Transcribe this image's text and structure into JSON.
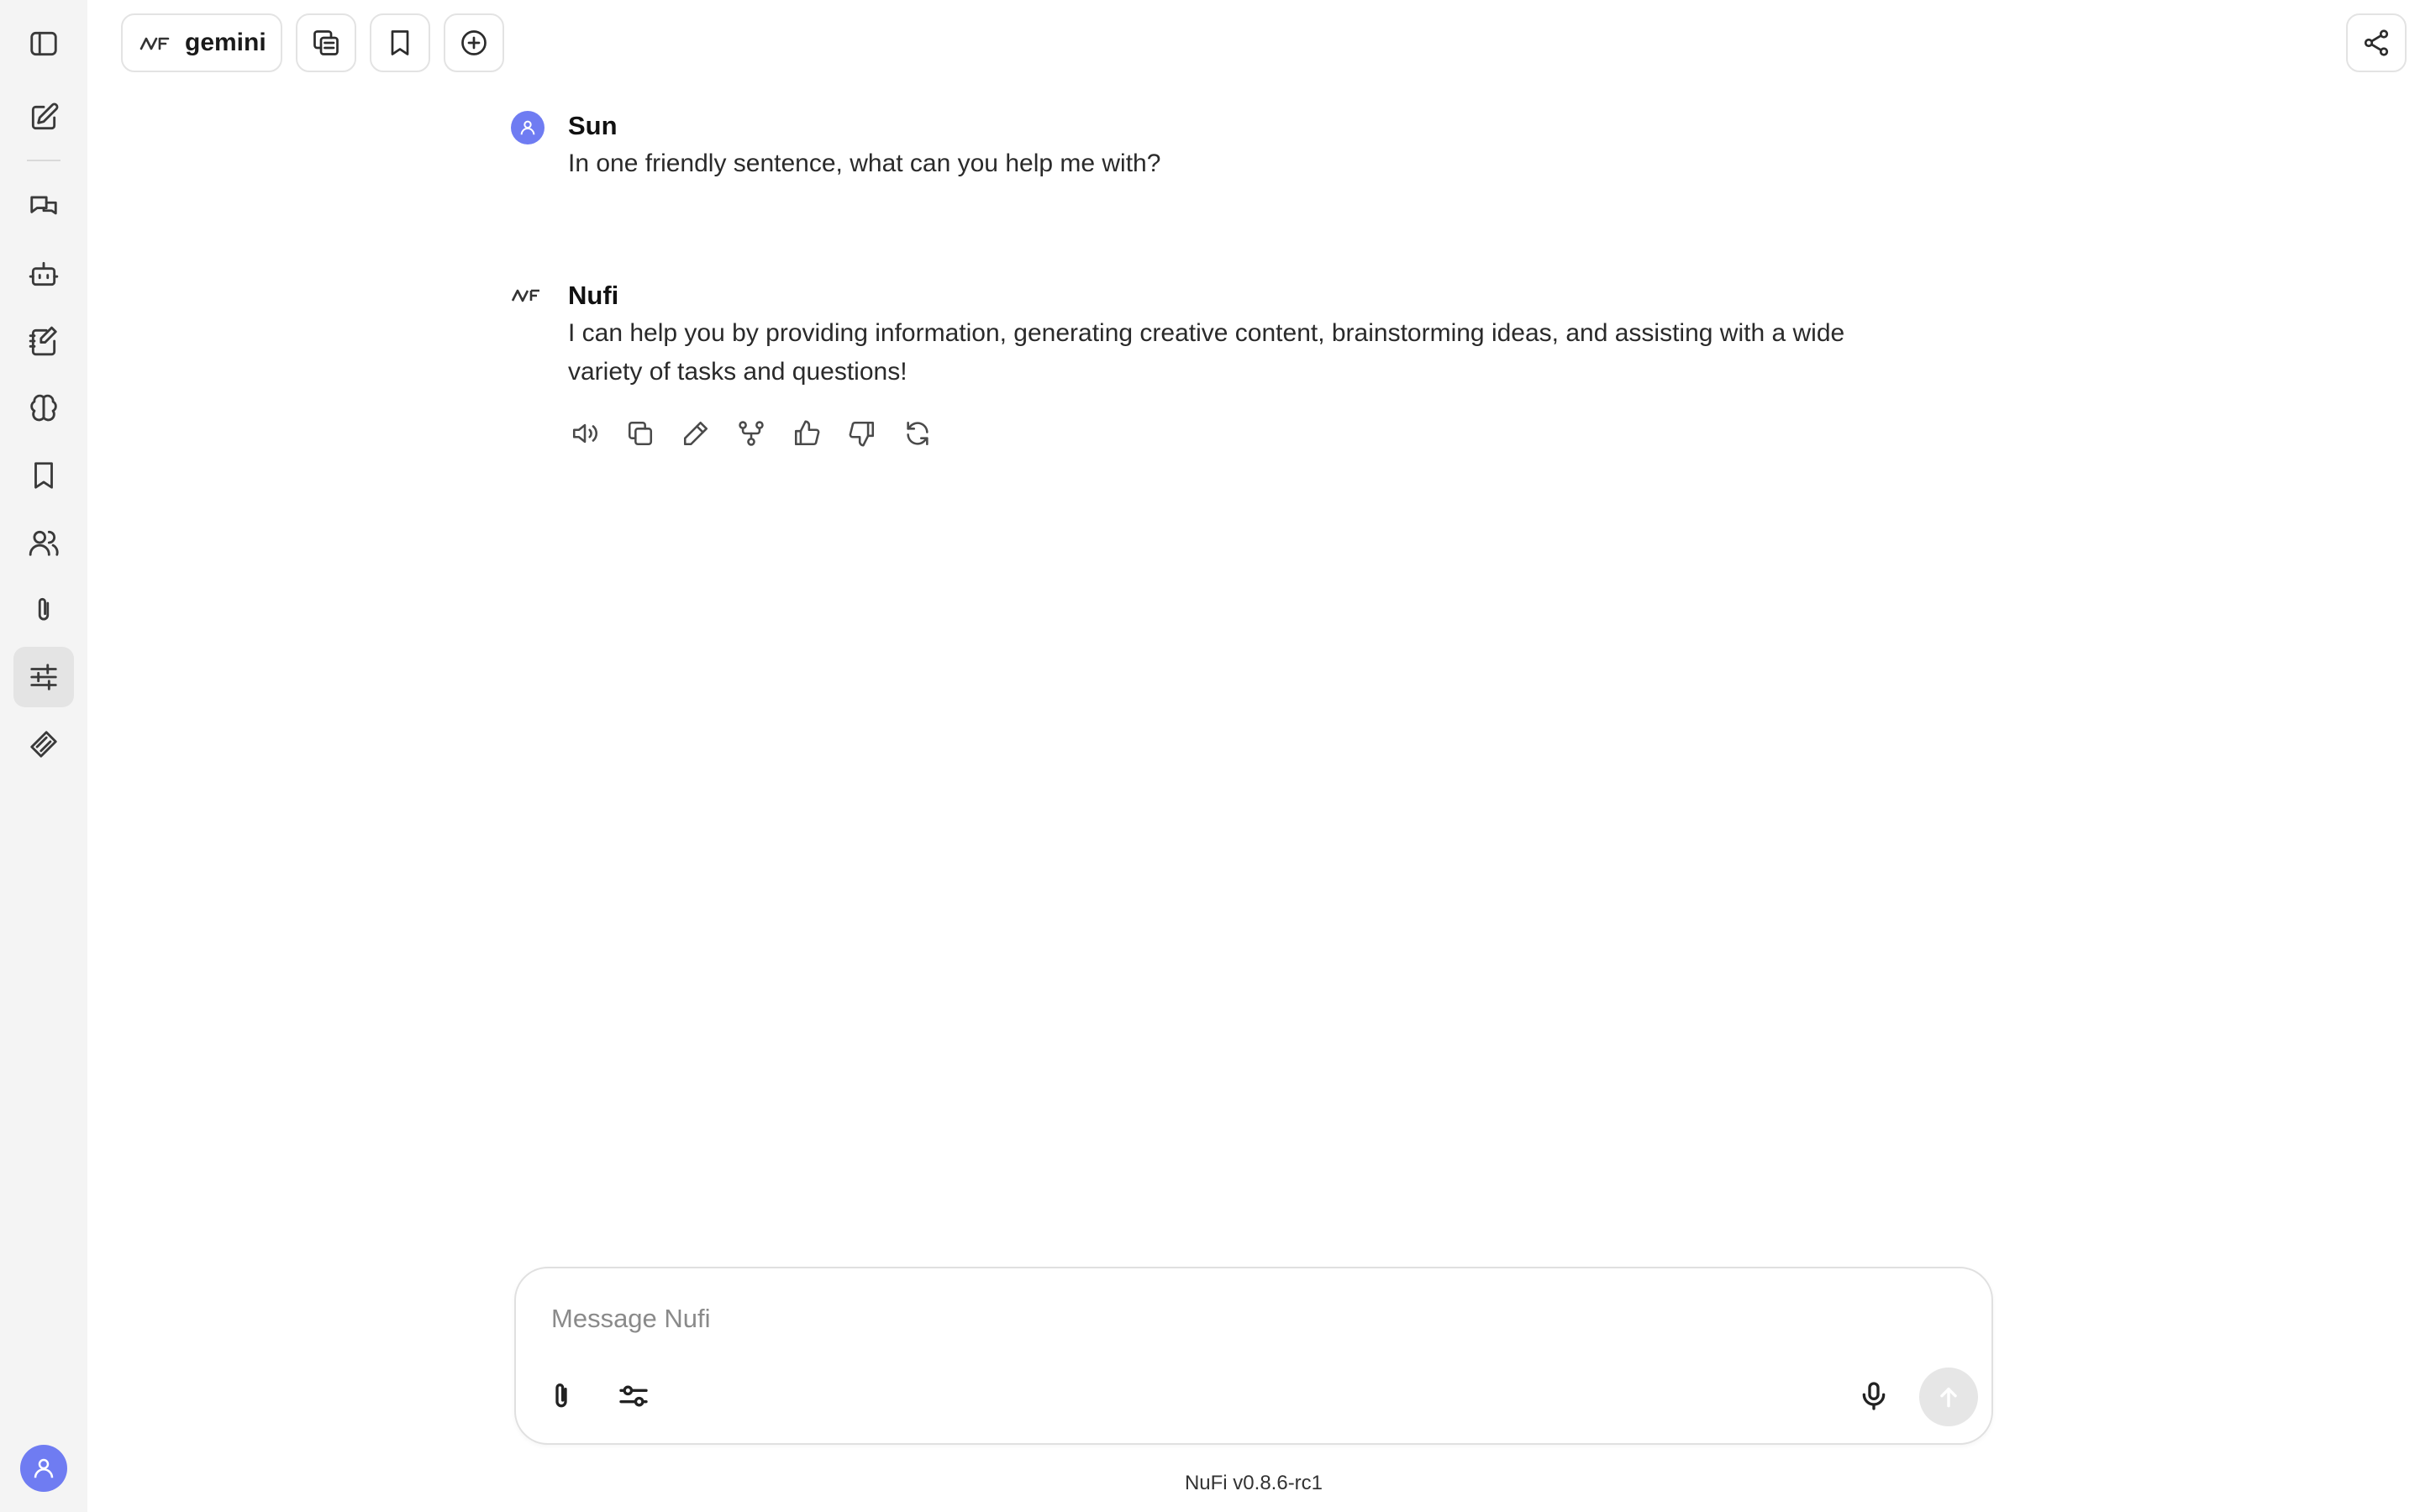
{
  "header": {
    "model_label": "gemini"
  },
  "sidebar": {
    "items": [
      {
        "icon": "sidebar-toggle-icon"
      },
      {
        "icon": "new-chat-icon"
      },
      {
        "icon": "conversations-icon"
      },
      {
        "icon": "agents-icon"
      },
      {
        "icon": "prompts-icon"
      },
      {
        "icon": "memories-icon"
      },
      {
        "icon": "bookmarks-icon"
      },
      {
        "icon": "users-icon"
      },
      {
        "icon": "attachments-icon"
      },
      {
        "icon": "parameters-icon",
        "active": true
      },
      {
        "icon": "tools-icon"
      }
    ]
  },
  "messages": [
    {
      "author": "Sun",
      "text": "In one friendly sentence, what can you help me with?"
    },
    {
      "author": "Nufi",
      "text": "I can help you by providing information, generating creative content, brainstorming ideas, and assisting with a wide variety of tasks and questions!"
    }
  ],
  "message_actions": [
    "read-aloud-icon",
    "copy-icon",
    "edit-icon",
    "fork-icon",
    "thumbs-up-icon",
    "thumbs-down-icon",
    "regenerate-icon"
  ],
  "composer": {
    "placeholder": "Message Nufi"
  },
  "footer": {
    "version": "NuFi v0.8.6-rc1"
  },
  "colors": {
    "accent": "#6f7cf2",
    "rail_bg": "#f4f4f4",
    "active_item_bg": "#e4e4e4"
  }
}
